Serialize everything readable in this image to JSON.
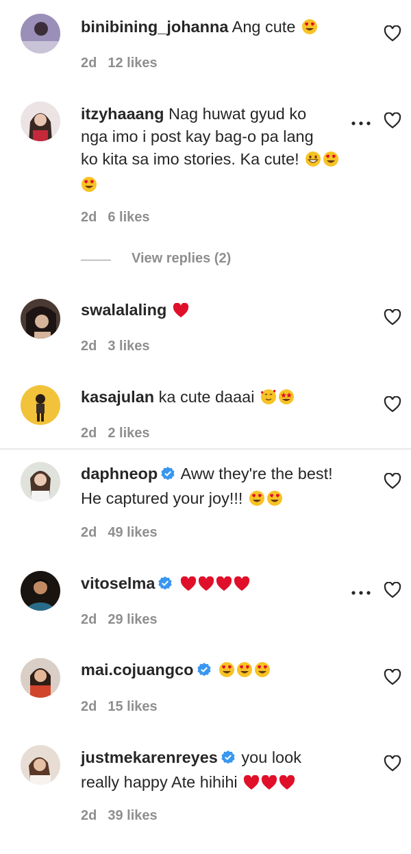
{
  "comments": [
    {
      "username": "binibining_johanna",
      "text": "Ang cute",
      "emoji": [
        "heart-eyes"
      ],
      "time": "2d",
      "likes": "12 likes",
      "verified": false
    },
    {
      "username": "itzyhaaang",
      "text_lines": [
        "Nag huwat gyud ko",
        "nga imo i post kay bag-o pa lang",
        "ko kita sa imo stories. Ka cute!"
      ],
      "emoji": [
        "grin",
        "heart-eyes",
        "heart-eyes"
      ],
      "time": "2d",
      "likes": "6 likes",
      "verified": false
    },
    {
      "username": "swalalaling",
      "text": "",
      "emoji": [
        "red-heart"
      ],
      "time": "2d",
      "likes": "3 likes",
      "verified": false
    },
    {
      "username": "kasajulan",
      "text": "ka cute daaai",
      "emoji": [
        "smiling-face-with-hearts",
        "star-struck"
      ],
      "time": "2d",
      "likes": "2 likes",
      "verified": false
    },
    {
      "username": "daphneop",
      "text_lines": [
        "Aww they're the best!",
        "He captured your joy!!!"
      ],
      "emoji": [
        "heart-eyes",
        "heart-eyes"
      ],
      "time": "2d",
      "likes": "49 likes",
      "verified": true
    },
    {
      "username": "vitoselma",
      "text": "",
      "emoji": [
        "red-heart",
        "red-heart",
        "red-heart",
        "red-heart"
      ],
      "time": "2d",
      "likes": "29 likes",
      "verified": true
    },
    {
      "username": "mai.cojuangco",
      "text": "",
      "emoji": [
        "heart-eyes",
        "heart-eyes",
        "heart-eyes"
      ],
      "time": "2d",
      "likes": "15 likes",
      "verified": true
    },
    {
      "username": "justmekarenreyes",
      "text_lines": [
        "you look",
        "really happy Ate hihihi"
      ],
      "emoji": [
        "red-heart",
        "red-heart",
        "red-heart"
      ],
      "time": "2d",
      "likes": "39 likes",
      "verified": true
    }
  ],
  "view_replies": "View replies (2)",
  "more_icon": "more-dots-icon",
  "like_icon": "heart-outline-icon",
  "colors": {
    "text": "#262626",
    "meta": "#8e8e8e",
    "verified": "#3897f0",
    "heart": "#e0102a"
  }
}
